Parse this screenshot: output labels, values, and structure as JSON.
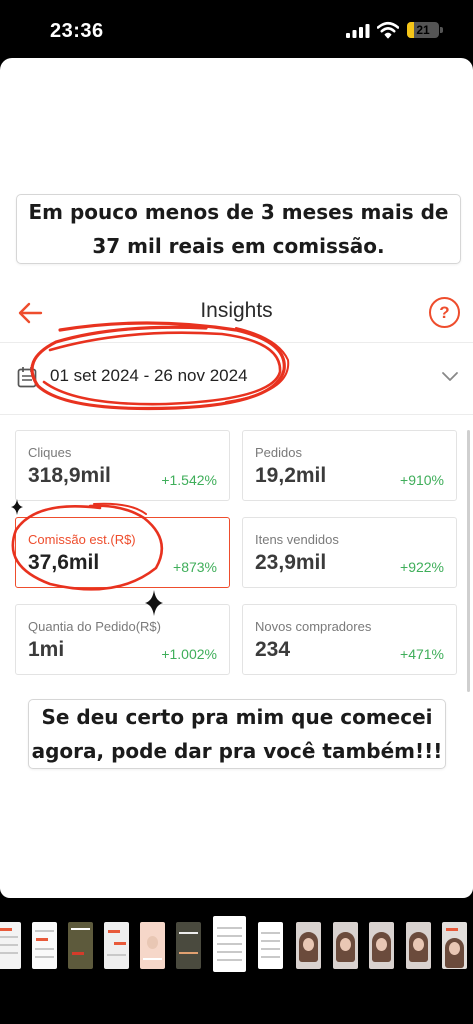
{
  "status_bar": {
    "time": "23:36",
    "battery_level": "21",
    "battery_fill_fraction": 0.21,
    "battery_color": "#f5c518"
  },
  "captions": {
    "top_line1": "Em pouco menos de 3 meses mais de",
    "top_line2": "37 mil reais em comissão.",
    "bottom_line1": "Se deu certo pra mim que comecei",
    "bottom_line2": "agora, pode dar pra você também!!!"
  },
  "header": {
    "title": "Insights",
    "back_icon": "arrow-left-icon",
    "help_icon": "question-circle-icon",
    "help_glyph": "?"
  },
  "date_range": {
    "label": "01 set 2024 - 26 nov 2024",
    "icon": "calendar-icon"
  },
  "metrics": [
    {
      "label": "Cliques",
      "value": "318,9mil",
      "change": "+1.542%"
    },
    {
      "label": "Pedidos",
      "value": "19,2mil",
      "change": "+910%"
    },
    {
      "label": "Comissão est.(R$)",
      "value": "37,6mil",
      "change": "+873%"
    },
    {
      "label": "Itens vendidos",
      "value": "23,9mil",
      "change": "+922%"
    },
    {
      "label": "Quantia do Pedido(R$)",
      "value": "1mi",
      "change": "+1.002%"
    },
    {
      "label": "Novos compradores",
      "value": "234",
      "change": "+471%"
    }
  ],
  "colors": {
    "accent": "#ee4d2d",
    "positive": "#3fae5a",
    "scribble": "#e8321f"
  }
}
